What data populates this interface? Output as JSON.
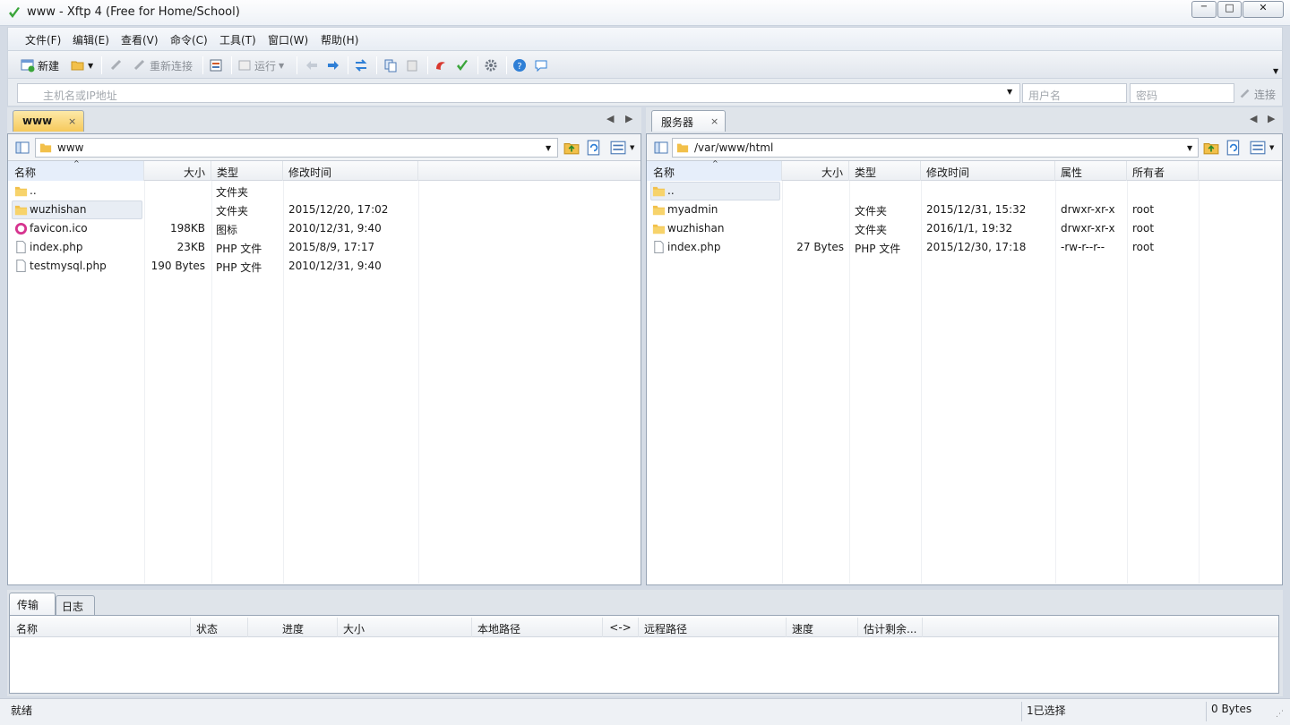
{
  "window": {
    "title": "www - Xftp 4 (Free for Home/School)",
    "minimize": "−",
    "maximize": "□",
    "close": "✕"
  },
  "menu": [
    "文件(F)",
    "编辑(E)",
    "查看(V)",
    "命令(C)",
    "工具(T)",
    "窗口(W)",
    "帮助(H)"
  ],
  "toolbar": {
    "new_label": "新建",
    "reconnect_label": "重新连接",
    "run_label": "运行"
  },
  "address": {
    "host_placeholder": "主机名或IP地址",
    "user_placeholder": "用户名",
    "password_placeholder": "密码",
    "connect_label": "连接"
  },
  "local": {
    "tab_label": "www",
    "path": "www",
    "columns": [
      "名称",
      "大小",
      "类型",
      "修改时间"
    ],
    "rows": [
      {
        "name": "..",
        "size": "",
        "type": "文件夹",
        "modified": "",
        "icon": "folder"
      },
      {
        "name": "wuzhishan",
        "size": "",
        "type": "文件夹",
        "modified": "2015/12/20, 17:02",
        "icon": "folder"
      },
      {
        "name": "favicon.ico",
        "size": "198KB",
        "type": "图标",
        "modified": "2010/12/31, 9:40",
        "icon": "ico"
      },
      {
        "name": "index.php",
        "size": "23KB",
        "type": "PHP 文件",
        "modified": "2015/8/9, 17:17",
        "icon": "file"
      },
      {
        "name": "testmysql.php",
        "size": "190 Bytes",
        "type": "PHP 文件",
        "modified": "2010/12/31, 9:40",
        "icon": "file"
      }
    ]
  },
  "remote": {
    "tab_label": "服务器",
    "path": "/var/www/html",
    "columns": [
      "名称",
      "大小",
      "类型",
      "修改时间",
      "属性",
      "所有者"
    ],
    "rows": [
      {
        "name": "..",
        "size": "",
        "type": "",
        "modified": "",
        "attr": "",
        "owner": "",
        "icon": "folder"
      },
      {
        "name": "myadmin",
        "size": "",
        "type": "文件夹",
        "modified": "2015/12/31, 15:32",
        "attr": "drwxr-xr-x",
        "owner": "root",
        "icon": "folder"
      },
      {
        "name": "wuzhishan",
        "size": "",
        "type": "文件夹",
        "modified": "2016/1/1, 19:32",
        "attr": "drwxr-xr-x",
        "owner": "root",
        "icon": "folder"
      },
      {
        "name": "index.php",
        "size": "27 Bytes",
        "type": "PHP 文件",
        "modified": "2015/12/30, 17:18",
        "attr": "-rw-r--r--",
        "owner": "root",
        "icon": "file"
      }
    ]
  },
  "transfer": {
    "tabs": [
      "传输",
      "日志"
    ],
    "columns": [
      "名称",
      "状态",
      "进度",
      "大小",
      "本地路径",
      "<->",
      "远程路径",
      "速度",
      "估计剩余..."
    ]
  },
  "status": {
    "left": "就绪",
    "selection": "1已选择",
    "size": "0 Bytes"
  },
  "colors": {
    "local_tab": "#f6c95b",
    "selection": "#e8edf4",
    "link_blue": "#2f7fd6"
  }
}
